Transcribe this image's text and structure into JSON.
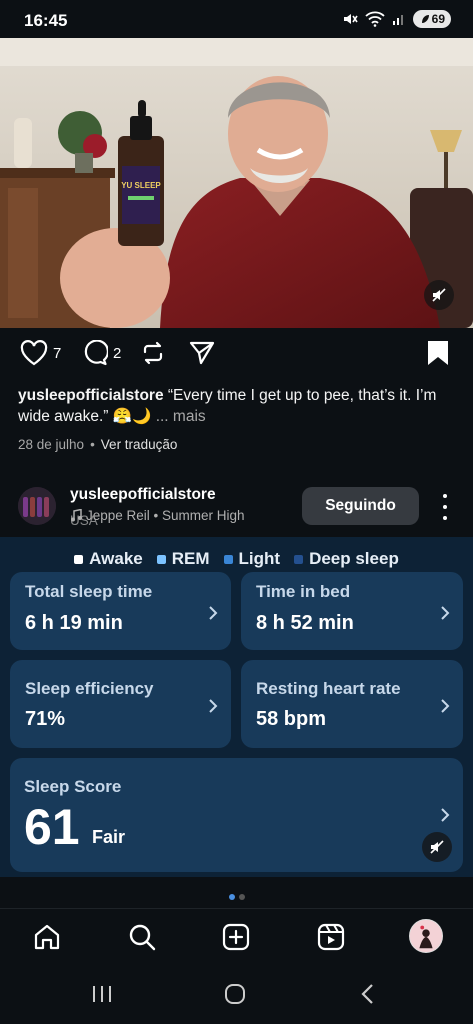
{
  "status_bar": {
    "time": "16:45",
    "battery": "69"
  },
  "post": {
    "likes": "7",
    "comments": "2",
    "caption_user": "yusleepofficialstore",
    "caption_text": "“Every time I get up to pee, that’s it. I’m wide awake.” 😤🌙",
    "caption_more": "... mais",
    "date": "28 de julho",
    "translate": "Ver tradução",
    "product_label": "YU SLEEP"
  },
  "profile": {
    "username": "yusleepofficialstore",
    "audio": "Jeppe Reil • Summer High",
    "country": "USA",
    "follow_label": "Seguindo"
  },
  "sleep": {
    "legend": [
      {
        "label": "Awake",
        "color": "#ffffff"
      },
      {
        "label": "REM",
        "color": "#7cc3ff"
      },
      {
        "label": "Light",
        "color": "#3a86d6"
      },
      {
        "label": "Deep sleep",
        "color": "#24508f"
      }
    ],
    "cards": [
      {
        "title": "Total sleep time",
        "value": "6 h 19 min"
      },
      {
        "title": "Time in bed",
        "value": "8 h 52 min"
      },
      {
        "title": "Sleep efficiency",
        "value": "71%"
      },
      {
        "title": "Resting heart rate",
        "value": "58 bpm"
      }
    ],
    "score": {
      "title": "Sleep Score",
      "value": "61",
      "label": "Fair"
    }
  },
  "colors": {
    "accent": "#4a90e2",
    "panel": "#0d2236",
    "card": "#183a5a"
  }
}
